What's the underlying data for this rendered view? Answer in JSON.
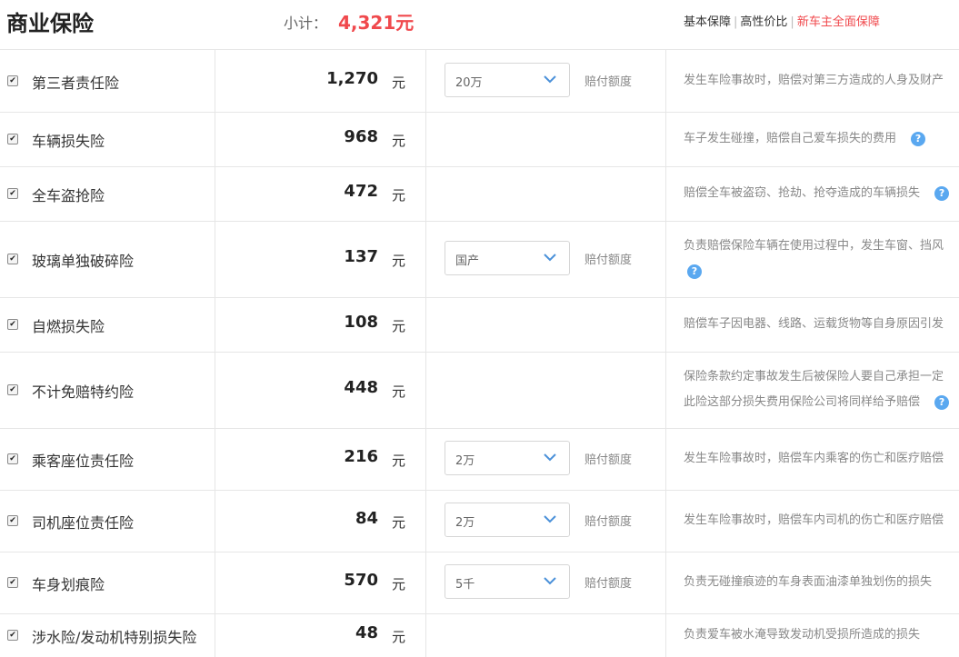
{
  "header": {
    "title": "商业保险",
    "subtotal_label": "小计：",
    "subtotal_value": "4,321元",
    "plans": [
      "基本保障",
      "高性价比",
      "新车主全面保障"
    ],
    "active_plan_index": 2,
    "accent_color": "#f0494d"
  },
  "unit": "元",
  "coverage_label": "赔付额度",
  "help_icon": "question-circle-icon",
  "rows": [
    {
      "name": "第三者责任险",
      "price": "1,270",
      "select": "20万",
      "desc": [
        "发生车险事故时，赔偿对第三方造成的人身及财产"
      ],
      "help": false
    },
    {
      "name": "车辆损失险",
      "price": "968",
      "desc": [
        "车子发生碰撞，赔偿自己爱车损失的费用"
      ],
      "help": true
    },
    {
      "name": "全车盗抢险",
      "price": "472",
      "desc": [
        "赔偿全车被盗窃、抢劫、抢夺造成的车辆损失"
      ],
      "help": true
    },
    {
      "name": "玻璃单独破碎险",
      "price": "137",
      "select": "国产",
      "desc": [
        "负责赔偿保险车辆在使用过程中，发生车窗、挡风"
      ],
      "help": true
    },
    {
      "name": "自燃损失险",
      "price": "108",
      "desc": [
        "赔偿车子因电器、线路、运载货物等自身原因引发"
      ],
      "help": false
    },
    {
      "name": "不计免赔特约险",
      "price": "448",
      "desc": [
        "保险条款约定事故发生后被保险人要自己承担一定",
        "此险这部分损失费用保险公司将同样给予赔偿"
      ],
      "help": true
    },
    {
      "name": "乘客座位责任险",
      "price": "216",
      "select": "2万",
      "desc": [
        "发生车险事故时，赔偿车内乘客的伤亡和医疗赔偿"
      ],
      "help": false
    },
    {
      "name": "司机座位责任险",
      "price": "84",
      "select": "2万",
      "desc": [
        "发生车险事故时，赔偿车内司机的伤亡和医疗赔偿"
      ],
      "help": false
    },
    {
      "name": "车身划痕险",
      "price": "570",
      "select": "5千",
      "desc": [
        "负责无碰撞痕迹的车身表面油漆单独划伤的损失"
      ],
      "help": false
    },
    {
      "name": "涉水险/发动机特别损失险",
      "price": "48",
      "desc": [
        "负责爱车被水淹导致发动机受损所造成的损失"
      ],
      "help": false
    }
  ]
}
